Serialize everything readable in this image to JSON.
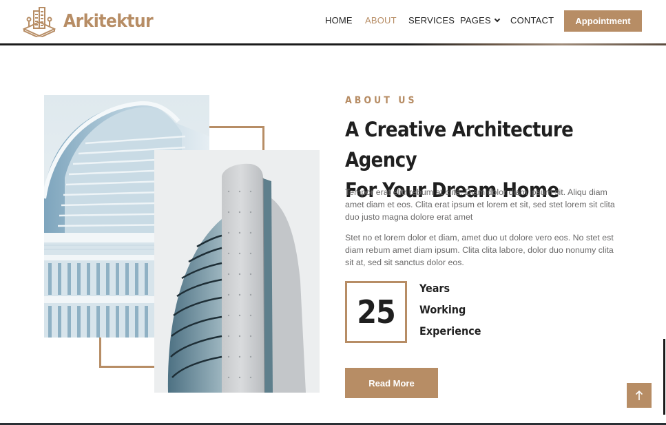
{
  "brand": {
    "name": "Arkitektur",
    "logo_icon": "building-logo-icon"
  },
  "nav": {
    "items": [
      {
        "label": "HOME",
        "active": false
      },
      {
        "label": "ABOUT",
        "active": true
      },
      {
        "label": "SERVICES",
        "active": false
      },
      {
        "label": "PAGES",
        "active": false,
        "dropdown": true
      },
      {
        "label": "CONTACT",
        "active": false
      }
    ],
    "cta_label": "Appointment"
  },
  "about": {
    "eyebrow": "ABOUT US",
    "headline_line1": "A Creative Architecture Agency",
    "headline_line2": "For Your Dream Home",
    "paragraph1": "Tempor erat elitr rebum at clita. Diam dolor diam ipsum sit. Aliqu diam amet diam et eos. Clita erat ipsum et lorem et sit, sed stet lorem sit clita duo justo magna dolore erat amet",
    "paragraph2": "Stet no et lorem dolor et diam, amet duo ut dolore vero eos. No stet est diam rebum amet diam ipsum. Clita clita labore, dolor duo nonumy clita sit at, sed sit sanctus dolor eos.",
    "years_value": "25",
    "experience_line1": "Years",
    "experience_line2": "Working",
    "experience_line3": "Experience",
    "read_more_label": "Read More"
  },
  "colors": {
    "accent": "#b78d65",
    "heading": "#1f1f1f",
    "body_text": "#6b6a6a"
  },
  "icons": {
    "back_to_top": "arrow-up-icon",
    "dropdown": "chevron-down-icon"
  }
}
